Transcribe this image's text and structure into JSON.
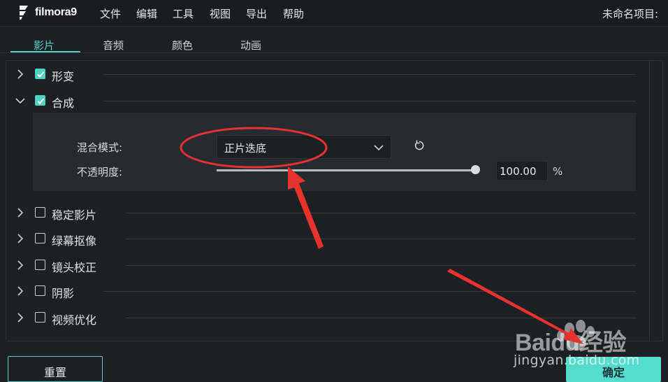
{
  "app": {
    "logo_text": "filmora9",
    "project_title": "未命名项目:"
  },
  "menu": [
    "文件",
    "编辑",
    "工具",
    "视图",
    "导出",
    "帮助"
  ],
  "tabs": [
    {
      "label": "影片",
      "active": true
    },
    {
      "label": "音频",
      "active": false
    },
    {
      "label": "颜色",
      "active": false
    },
    {
      "label": "动画",
      "active": false
    }
  ],
  "sections": [
    {
      "label": "形变",
      "checked": true,
      "expanded": false
    },
    {
      "label": "合成",
      "checked": true,
      "expanded": true
    },
    {
      "label": "稳定影片",
      "checked": false,
      "expanded": false
    },
    {
      "label": "绿幕抠像",
      "checked": false,
      "expanded": false
    },
    {
      "label": "镜头校正",
      "checked": false,
      "expanded": false
    },
    {
      "label": "阴影",
      "checked": false,
      "expanded": false
    },
    {
      "label": "视频优化",
      "checked": false,
      "expanded": false
    }
  ],
  "composite": {
    "blend_mode_label": "混合模式:",
    "blend_mode_value": "正片迭底",
    "opacity_label": "不透明度:",
    "opacity_value": "100.00",
    "opacity_unit": "%",
    "opacity_level": 1.0
  },
  "buttons": {
    "reset": "重置",
    "ok": "确定"
  },
  "watermark": {
    "brand": "Baidu经验",
    "url": "jingyan.baidu.com"
  },
  "colors": {
    "accent": "#4fd2c4",
    "annotation_red": "#e8322e",
    "bg": "#1c1f24"
  }
}
